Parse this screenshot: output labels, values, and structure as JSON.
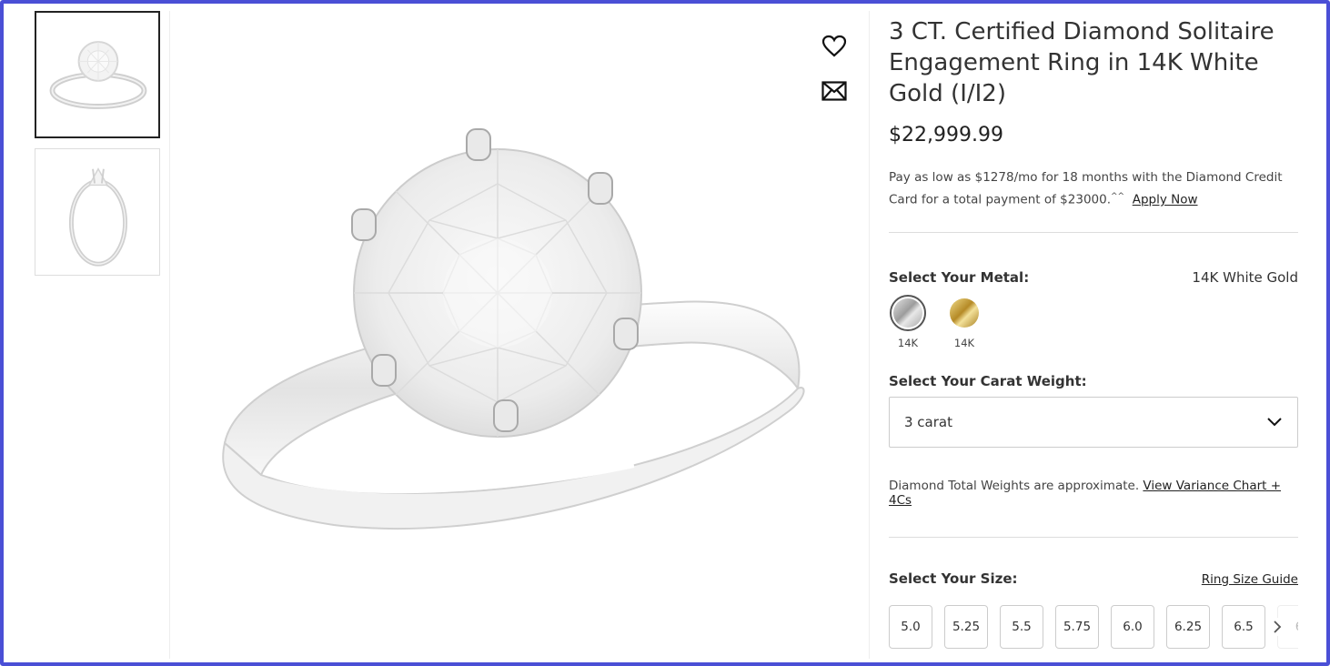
{
  "gallery": {
    "thumbnails": [
      {
        "alt": "ring-front-view",
        "active": true
      },
      {
        "alt": "ring-side-view",
        "active": false
      }
    ]
  },
  "product": {
    "title": "3 CT. Certified Diamond Solitaire Engagement Ring in 14K White Gold (I/I2)",
    "price": "$22,999.99",
    "credit_text": "Pay as low as $1278/mo for 18 months with the Diamond Credit Card for a total payment of $23000.",
    "credit_sup": "^^",
    "apply_now": "Apply Now"
  },
  "metal": {
    "label": "Select Your Metal:",
    "selected_name": "14K White Gold",
    "options": [
      {
        "caption": "14K",
        "color": "#b8b8b8",
        "selected": true
      },
      {
        "caption": "14K",
        "color": "#c9a845",
        "selected": false
      }
    ]
  },
  "carat": {
    "label": "Select Your Carat Weight:",
    "selected": "3 carat",
    "note": "Diamond Total Weights are approximate.",
    "note_link": "View Variance Chart + 4Cs"
  },
  "size": {
    "label": "Select Your Size:",
    "guide_link": "Ring Size Guide",
    "options": [
      "5.0",
      "5.25",
      "5.5",
      "5.75",
      "6.0",
      "6.25",
      "6.5",
      "6"
    ]
  },
  "icons": {
    "wishlist": "heart-icon",
    "share": "envelope-icon",
    "dropdown": "chevron-down-icon",
    "next": "chevron-right-icon"
  },
  "colors": {
    "accent_border": "#4a4fd6",
    "text": "#222222"
  }
}
